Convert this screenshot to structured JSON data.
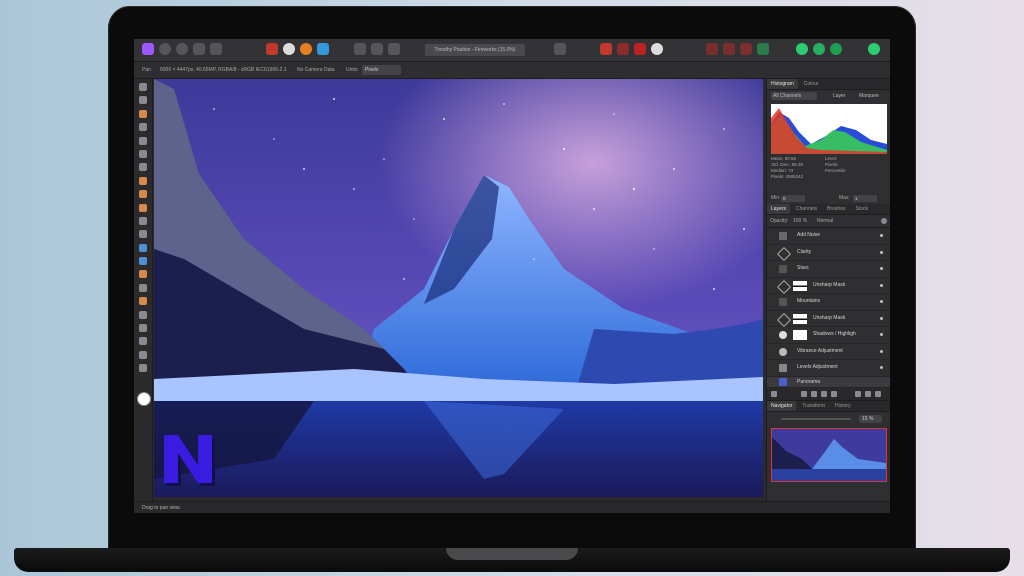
{
  "app": {
    "document_title": "Timothy Poulton - Fireworks (15.0%)"
  },
  "context_bar": {
    "tool": "Pan",
    "dimensions": "6000 × 4447px, 40.65MP, RGBA/8 - sRGB IEC61966-2.1",
    "camera": "No Camera Data",
    "units_label": "Units:",
    "units_value": "Pixels"
  },
  "histogram": {
    "tabs": [
      "Histogram",
      "Colour"
    ],
    "channel_select": "All Channels",
    "layer_label": "Layer",
    "marquee_label": "Marquee",
    "stats_left": [
      "Mean: 80.56",
      "Std. Dev.: 68.28",
      "Median: 73",
      "Pixels: 4586242"
    ],
    "stats_right": [
      "Level:",
      "Pixels:",
      "Percentile:"
    ],
    "min_label": "Min:",
    "min_value": "0",
    "max_label": "Max:",
    "max_value": "1"
  },
  "layers_panel": {
    "tabs": [
      "Layers",
      "Channels",
      "Brushes",
      "Stock"
    ],
    "opacity_label": "Opacity:",
    "opacity_value": "100 %",
    "blend_mode": "Normal",
    "layers": [
      {
        "name": "Add Noise"
      },
      {
        "name": "Clarity"
      },
      {
        "name": "Stars"
      },
      {
        "name": "Unsharp Mask"
      },
      {
        "name": "Mountains"
      },
      {
        "name": "Unsharp Mask"
      },
      {
        "name": "Shadows / Highligh"
      },
      {
        "name": "Vibrance Adjustment"
      },
      {
        "name": "Levels Adjustment"
      },
      {
        "name": "Panorama"
      }
    ]
  },
  "navigator": {
    "tabs": [
      "Navigator",
      "Transform",
      "History"
    ],
    "zoom_value": "15 %"
  },
  "status_bar": {
    "text": "Drag to pan view."
  },
  "overlay_logo": {
    "letter": "N",
    "color": "#3a1be0"
  }
}
